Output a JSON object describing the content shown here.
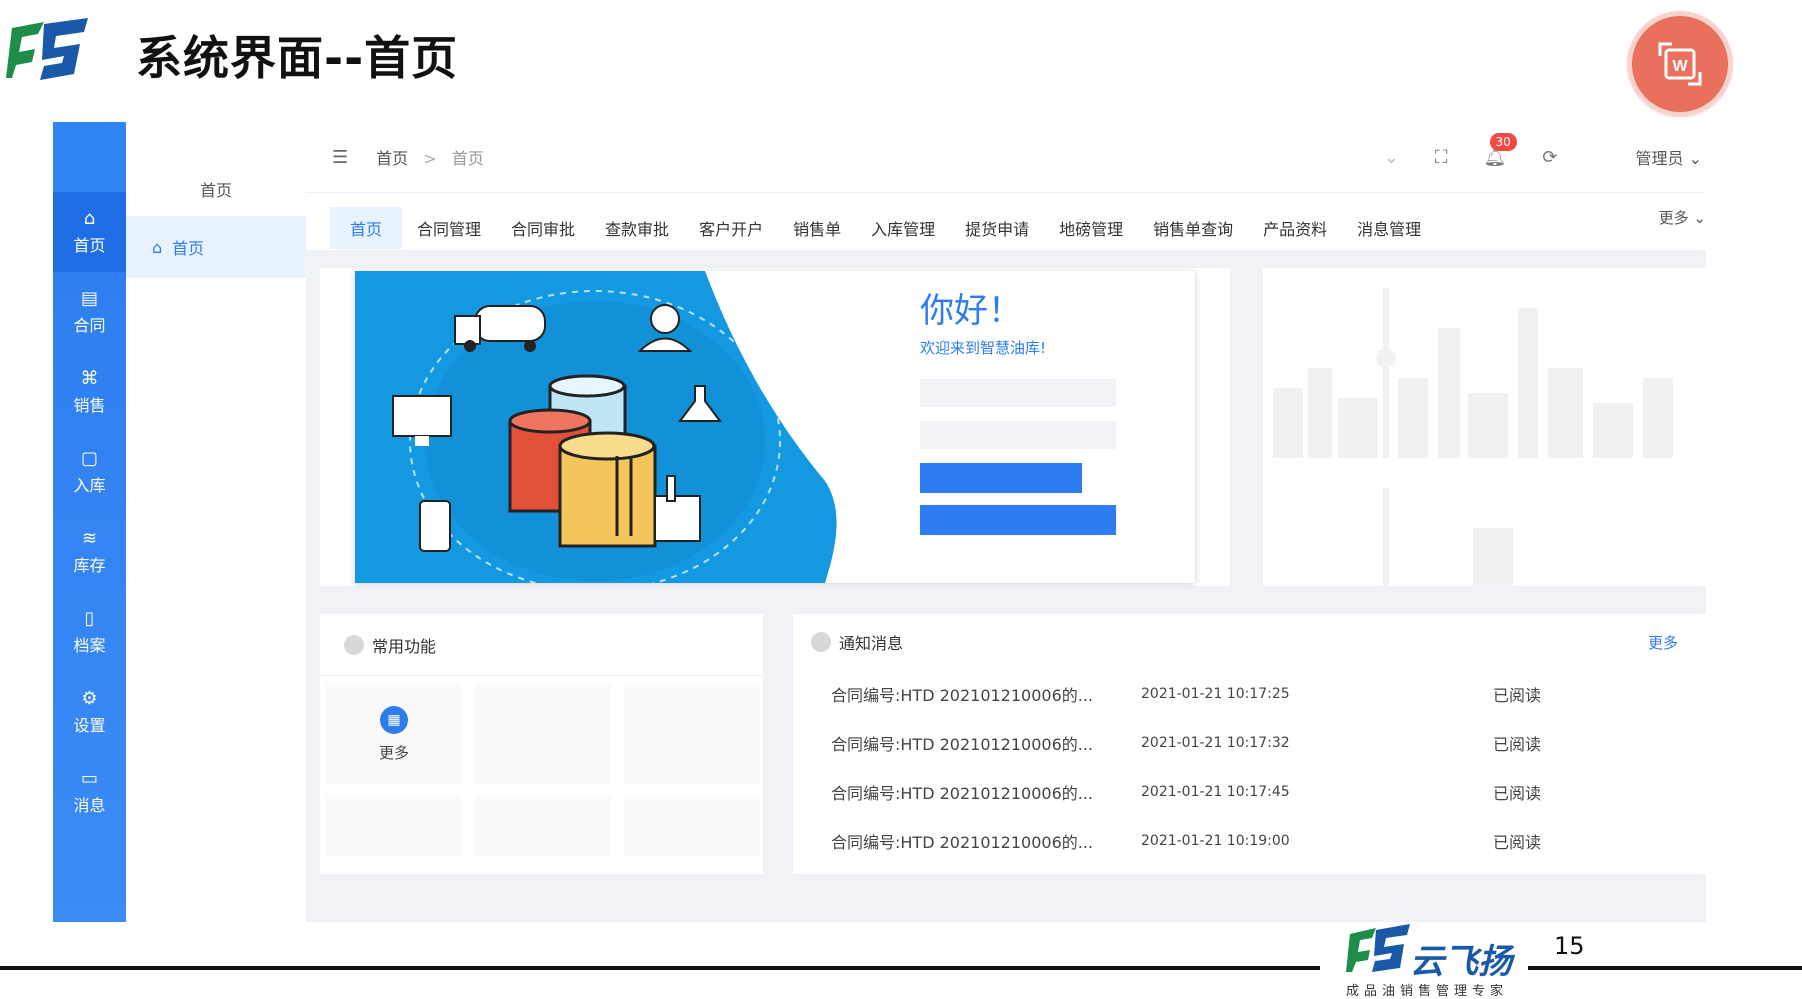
{
  "slide": {
    "title": "系统界面--首页",
    "page_number": "15"
  },
  "brand": {
    "name": "云飞扬",
    "tagline": "成品油销售管理专家"
  },
  "rail": {
    "items": [
      {
        "label": "首页",
        "icon": "home-icon"
      },
      {
        "label": "合同",
        "icon": "contract-icon"
      },
      {
        "label": "销售",
        "icon": "sales-icon"
      },
      {
        "label": "入库",
        "icon": "inbound-icon"
      },
      {
        "label": "库存",
        "icon": "database-icon"
      },
      {
        "label": "档案",
        "icon": "archive-icon"
      },
      {
        "label": "设置",
        "icon": "settings-icon"
      },
      {
        "label": "消息",
        "icon": "message-icon"
      }
    ]
  },
  "submenu": {
    "title": "首页",
    "item": "首页"
  },
  "topbar": {
    "breadcrumb": [
      "首页",
      "首页"
    ],
    "breadcrumb_sep": ">",
    "notification_count": "30",
    "user": "管理员"
  },
  "tabs": {
    "items": [
      "首页",
      "合同管理",
      "合同审批",
      "查款审批",
      "客户开户",
      "销售单",
      "入库管理",
      "提货申请",
      "地磅管理",
      "销售单查询",
      "产品资料",
      "消息管理"
    ],
    "more": "更多"
  },
  "banner": {
    "hello": "你好！",
    "welcome": "欢迎来到智慧油库!"
  },
  "functions": {
    "title": "常用功能",
    "more_label": "更多"
  },
  "notices": {
    "title": "通知消息",
    "more": "更多",
    "rows": [
      {
        "title": "合同编号:HTD  202101210006的...",
        "time": "2021-01-21 10:17:25",
        "status": "已阅读"
      },
      {
        "title": "合同编号:HTD  202101210006的...",
        "time": "2021-01-21 10:17:32",
        "status": "已阅读"
      },
      {
        "title": "合同编号:HTD  202101210006的...",
        "time": "2021-01-21 10:17:45",
        "status": "已阅读"
      },
      {
        "title": "合同编号:HTD  202101210006的...",
        "time": "2021-01-21 10:19:00",
        "status": "已阅读"
      }
    ]
  },
  "colors": {
    "primary": "#2d7cf0",
    "rail": "#2f86f3",
    "badge": "#f04b43",
    "brand": "#1a58a8",
    "w_badge": "#e8705c"
  }
}
